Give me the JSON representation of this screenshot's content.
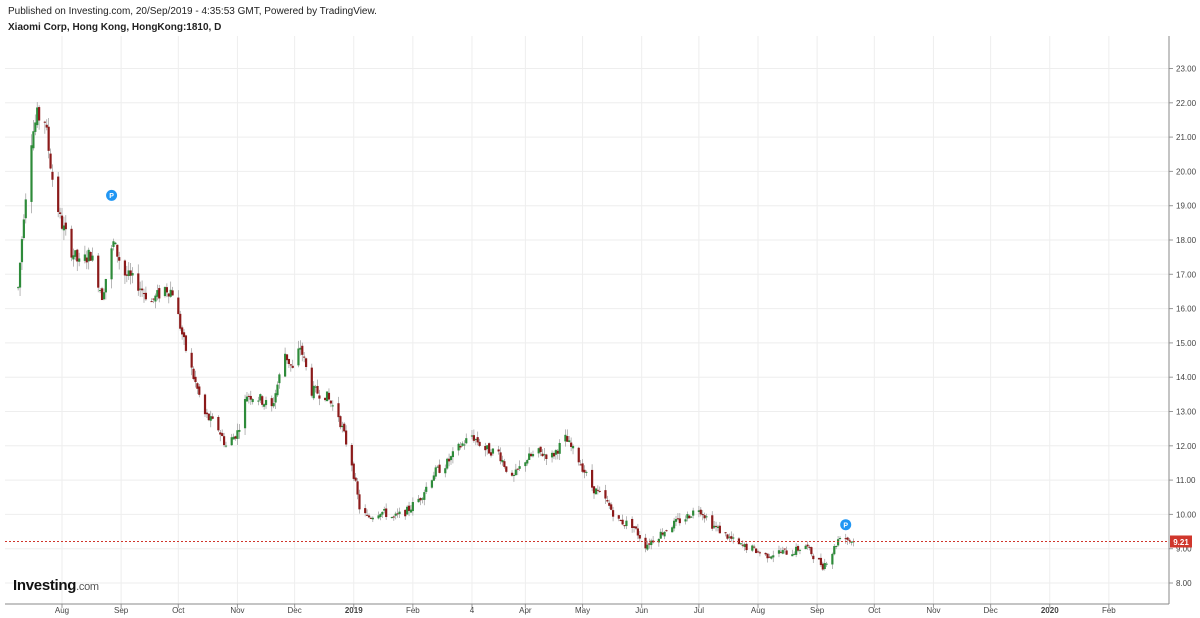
{
  "header": {
    "published": "Published on Investing.com, 20/Sep/2019 - 4:35:53 GMT, Powered by TradingView.",
    "symbol": "Xiaomi Corp, Hong Kong, HongKong:1810, D"
  },
  "logo": {
    "name": "Investing",
    "suffix": ".com"
  },
  "colors": {
    "up": "#2e8b3a",
    "down": "#8b1a1a",
    "price_line": "#d0362c",
    "grid": "#eeeeee",
    "axis_text": "#444444",
    "marker": "#2196f3"
  },
  "chart_data": {
    "type": "candlestick",
    "title": "Xiaomi Corp, Hong Kong, HongKong:1810, D",
    "ylim": [
      7.5,
      23.9
    ],
    "yticks": [
      "8.00",
      "9.00",
      "10.00",
      "11.00",
      "12.00",
      "13.00",
      "14.00",
      "15.00",
      "16.00",
      "17.00",
      "18.00",
      "19.00",
      "20.00",
      "21.00",
      "22.00",
      "23.00"
    ],
    "xticks": [
      {
        "label": "Aug",
        "date": "2018-08-01"
      },
      {
        "label": "Sep",
        "date": "2018-09-01"
      },
      {
        "label": "Oct",
        "date": "2018-10-01"
      },
      {
        "label": "Nov",
        "date": "2018-11-01"
      },
      {
        "label": "Dec",
        "date": "2018-12-01"
      },
      {
        "label": "2019",
        "date": "2019-01-01",
        "bold": true
      },
      {
        "label": "Feb",
        "date": "2019-02-01"
      },
      {
        "label": "4",
        "date": "2019-03-04"
      },
      {
        "label": "Apr",
        "date": "2019-04-01"
      },
      {
        "label": "May",
        "date": "2019-05-01"
      },
      {
        "label": "Jun",
        "date": "2019-06-01"
      },
      {
        "label": "Jul",
        "date": "2019-07-01"
      },
      {
        "label": "Aug",
        "date": "2019-08-01"
      },
      {
        "label": "Sep",
        "date": "2019-09-01"
      },
      {
        "label": "Oct",
        "date": "2019-10-01"
      },
      {
        "label": "Nov",
        "date": "2019-11-01"
      },
      {
        "label": "Dec",
        "date": "2019-12-01"
      },
      {
        "label": "2020",
        "date": "2020-01-01",
        "bold": true
      },
      {
        "label": "Feb",
        "date": "2020-02-01"
      }
    ],
    "x_end": "2020-02-20",
    "last_price": 9.21,
    "last_price_label": "9.21",
    "markers": [
      {
        "label": "P",
        "date": "2018-08-27",
        "value": 19.3
      },
      {
        "label": "P",
        "date": "2019-09-16",
        "value": 9.7
      }
    ],
    "price_path": [
      {
        "date": "2018-07-09",
        "value": 16.6
      },
      {
        "date": "2018-07-12",
        "value": 18.8
      },
      {
        "date": "2018-07-16",
        "value": 21.0
      },
      {
        "date": "2018-07-19",
        "value": 21.6
      },
      {
        "date": "2018-07-23",
        "value": 21.5
      },
      {
        "date": "2018-07-27",
        "value": 19.8
      },
      {
        "date": "2018-07-31",
        "value": 18.6
      },
      {
        "date": "2018-08-06",
        "value": 17.7
      },
      {
        "date": "2018-08-10",
        "value": 17.3
      },
      {
        "date": "2018-08-16",
        "value": 17.6
      },
      {
        "date": "2018-08-22",
        "value": 16.4
      },
      {
        "date": "2018-08-28",
        "value": 17.9
      },
      {
        "date": "2018-09-03",
        "value": 17.0
      },
      {
        "date": "2018-09-10",
        "value": 16.7
      },
      {
        "date": "2018-09-17",
        "value": 16.2
      },
      {
        "date": "2018-09-24",
        "value": 16.6
      },
      {
        "date": "2018-09-28",
        "value": 16.5
      },
      {
        "date": "2018-10-04",
        "value": 15.0
      },
      {
        "date": "2018-10-09",
        "value": 14.0
      },
      {
        "date": "2018-10-15",
        "value": 12.9
      },
      {
        "date": "2018-10-22",
        "value": 12.5
      },
      {
        "date": "2018-10-26",
        "value": 12.0
      },
      {
        "date": "2018-11-01",
        "value": 12.4
      },
      {
        "date": "2018-11-06",
        "value": 13.5
      },
      {
        "date": "2018-11-12",
        "value": 13.4
      },
      {
        "date": "2018-11-19",
        "value": 13.1
      },
      {
        "date": "2018-11-26",
        "value": 14.7
      },
      {
        "date": "2018-11-30",
        "value": 14.2
      },
      {
        "date": "2018-12-04",
        "value": 14.9
      },
      {
        "date": "2018-12-10",
        "value": 13.6
      },
      {
        "date": "2018-12-17",
        "value": 13.5
      },
      {
        "date": "2018-12-24",
        "value": 12.9
      },
      {
        "date": "2018-12-31",
        "value": 11.5
      },
      {
        "date": "2019-01-04",
        "value": 10.2
      },
      {
        "date": "2019-01-08",
        "value": 9.9
      },
      {
        "date": "2019-01-15",
        "value": 10.1
      },
      {
        "date": "2019-01-22",
        "value": 9.9
      },
      {
        "date": "2019-01-29",
        "value": 10.1
      },
      {
        "date": "2019-02-05",
        "value": 10.5
      },
      {
        "date": "2019-02-12",
        "value": 11.2
      },
      {
        "date": "2019-02-19",
        "value": 11.5
      },
      {
        "date": "2019-02-26",
        "value": 12.0
      },
      {
        "date": "2019-03-04",
        "value": 12.3
      },
      {
        "date": "2019-03-11",
        "value": 11.9
      },
      {
        "date": "2019-03-18",
        "value": 11.8
      },
      {
        "date": "2019-03-25",
        "value": 11.0
      },
      {
        "date": "2019-04-01",
        "value": 11.6
      },
      {
        "date": "2019-04-08",
        "value": 11.8
      },
      {
        "date": "2019-04-15",
        "value": 11.7
      },
      {
        "date": "2019-04-22",
        "value": 12.2
      },
      {
        "date": "2019-04-29",
        "value": 11.6
      },
      {
        "date": "2019-05-06",
        "value": 10.8
      },
      {
        "date": "2019-05-13",
        "value": 10.4
      },
      {
        "date": "2019-05-20",
        "value": 9.8
      },
      {
        "date": "2019-05-27",
        "value": 9.7
      },
      {
        "date": "2019-06-03",
        "value": 9.1
      },
      {
        "date": "2019-06-10",
        "value": 9.4
      },
      {
        "date": "2019-06-17",
        "value": 9.7
      },
      {
        "date": "2019-06-24",
        "value": 9.9
      },
      {
        "date": "2019-07-01",
        "value": 10.2
      },
      {
        "date": "2019-07-08",
        "value": 9.7
      },
      {
        "date": "2019-07-15",
        "value": 9.4
      },
      {
        "date": "2019-07-22",
        "value": 9.1
      },
      {
        "date": "2019-07-29",
        "value": 9.0
      },
      {
        "date": "2019-08-05",
        "value": 8.8
      },
      {
        "date": "2019-08-12",
        "value": 8.9
      },
      {
        "date": "2019-08-19",
        "value": 8.9
      },
      {
        "date": "2019-08-26",
        "value": 9.1
      },
      {
        "date": "2019-08-30",
        "value": 8.8
      },
      {
        "date": "2019-09-04",
        "value": 8.5
      },
      {
        "date": "2019-09-09",
        "value": 8.9
      },
      {
        "date": "2019-09-13",
        "value": 9.4
      },
      {
        "date": "2019-09-20",
        "value": 9.21
      }
    ]
  }
}
